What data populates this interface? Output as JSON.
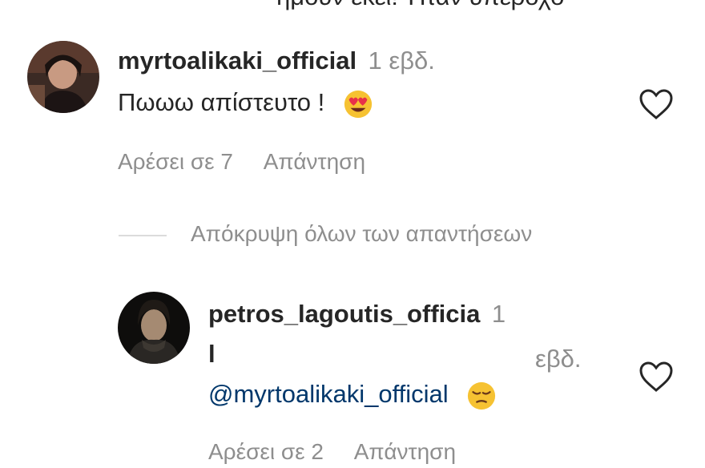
{
  "clipped_text": "ήμουν εκεί! Ήταν υπέροχο",
  "comments": [
    {
      "username": "myrtoalikaki_official",
      "time": "1 εβδ.",
      "text": "Πωωω απίστευτο !",
      "emoji": "heart-eyes-emoji",
      "likes": "Αρέσει σε 7",
      "reply": "Απάντηση"
    }
  ],
  "hide_replies": "Απόκρυψη όλων των απαντήσεων",
  "replies": [
    {
      "username_line1": "petros_lagoutis_officia",
      "username_line2": "l",
      "time_line1": "1",
      "time_line2": "εβδ.",
      "mention": "@myrtoalikaki_official",
      "emoji": "pensive-face-emoji",
      "likes": "Αρέσει σε 2",
      "reply": "Απάντηση"
    }
  ],
  "colors": {
    "text": "#262626",
    "secondary": "#8e8e8e",
    "mention": "#00376b",
    "divider": "#dbdbdb"
  }
}
